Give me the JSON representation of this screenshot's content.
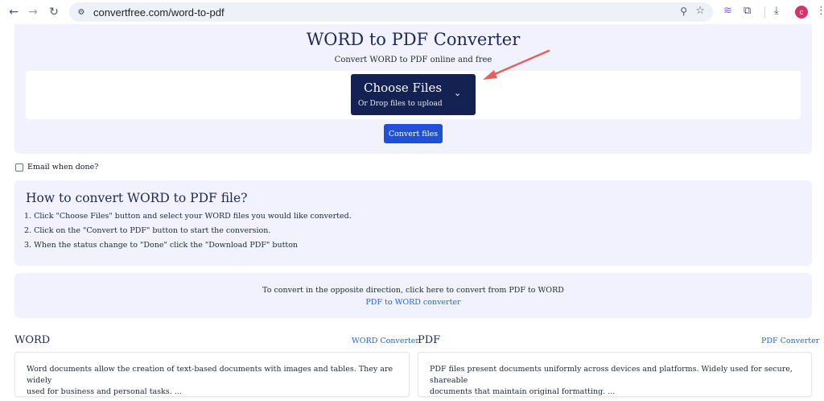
{
  "browser": {
    "url": "convertfree.com/word-to-pdf",
    "avatar_letter": "c"
  },
  "hero": {
    "title": "WORD to PDF Converter",
    "subtitle": "Convert WORD to PDF online and free",
    "choose_files_label": "Choose Files",
    "drop_hint": "Or Drop files to upload",
    "convert_label": "Convert files"
  },
  "email": {
    "label": "Email when done?",
    "checked": false
  },
  "howto": {
    "title": "How to convert WORD to PDF file?",
    "steps": [
      "1. Click \"Choose Files\" button and select your WORD files you would like converted.",
      "2. Click on the \"Convert to PDF\" button to start the conversion.",
      "3. When the status change to \"Done\" click the \"Download PDF\" button"
    ]
  },
  "opposite": {
    "text": "To convert in the opposite direction, click here to convert from PDF to WORD",
    "link": "PDF to WORD converter"
  },
  "formats": {
    "word": {
      "title": "WORD",
      "link": "WORD Converter",
      "description_line1": "Word documents allow the creation of text-based documents with images and tables. They are widely",
      "description_line2": "used for business and personal tasks. ..."
    },
    "pdf": {
      "title": "PDF",
      "link": "PDF Converter",
      "description_line1": "PDF files present documents uniformly across devices and platforms. Widely used for secure, shareable",
      "description_line2": "documents that maintain original formatting. ..."
    }
  },
  "colors": {
    "panel_bg": "#f1f2fd",
    "choose_btn": "#142253",
    "convert_btn": "#1e50d8",
    "link": "#2563eb",
    "annotation_arrow": "#e5605f"
  }
}
